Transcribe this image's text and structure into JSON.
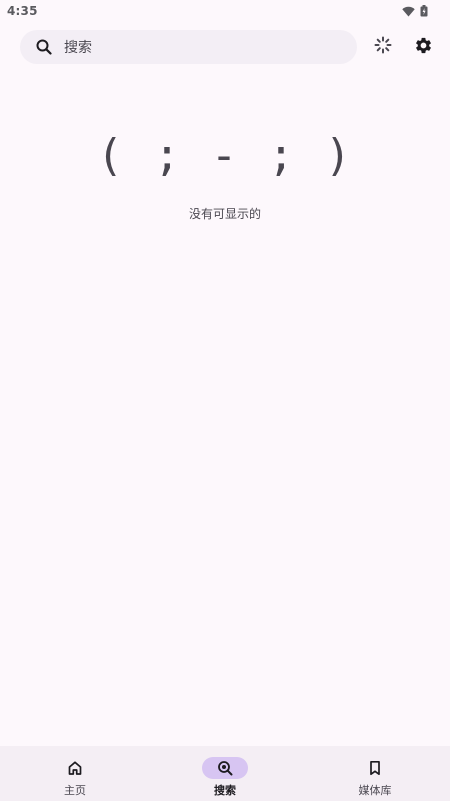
{
  "status_bar": {
    "time": "4:35",
    "icons": [
      "wifi-icon",
      "battery-icon"
    ]
  },
  "search": {
    "placeholder": "搜索",
    "icon": "search-icon"
  },
  "toolbar": {
    "loading_icon": "loading-spinner-icon",
    "settings_icon": "settings-gear-icon"
  },
  "empty_state": {
    "face": "( ; - ; )",
    "message": "没有可显示的"
  },
  "bottom_nav": {
    "items": [
      {
        "label": "主页",
        "icon": "home-icon",
        "active": false
      },
      {
        "label": "搜索",
        "icon": "search-icon",
        "active": true
      },
      {
        "label": "媒体库",
        "icon": "bookmark-icon",
        "active": false
      }
    ]
  },
  "colors": {
    "background": "#fdf8fc",
    "search_bar": "#f3eef5",
    "active_pill": "#d7c5f2",
    "nav_bar": "#f4eef4"
  }
}
